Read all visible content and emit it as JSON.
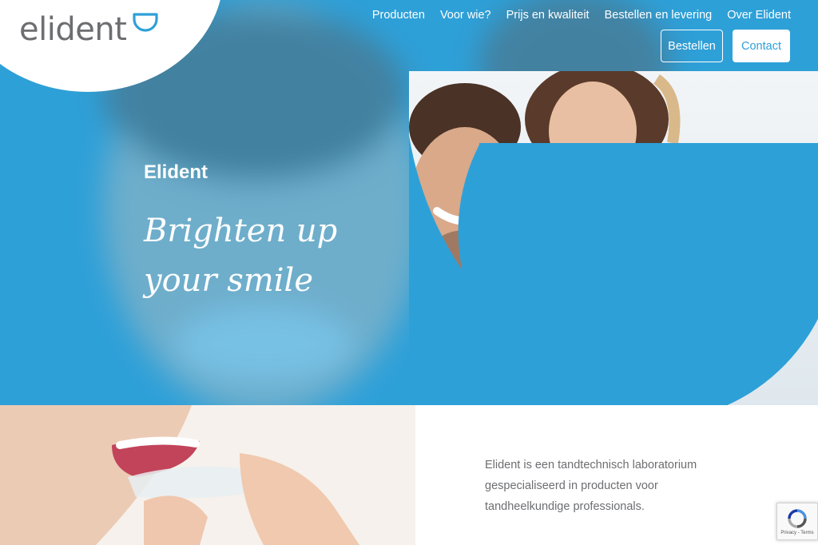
{
  "brand": {
    "logo_text": "elident",
    "logo_icon": "smile-icon"
  },
  "nav": {
    "items": [
      "Producten",
      "Voor wie?",
      "Prijs en kwaliteit",
      "Bestellen en levering",
      "Over Elident"
    ],
    "order_button": "Bestellen",
    "contact_button": "Contact"
  },
  "hero": {
    "label": "Elident",
    "tagline": "Brighten up your smile",
    "photo": "couple-smiling-photo"
  },
  "about": {
    "photo": "woman-inserting-aligner-photo",
    "text": "Elident is een tandtechnisch laboratorium gespecialiseerd in producten voor tandheelkundige professionals."
  },
  "recaptcha": {
    "label": "Privacy - Terms",
    "icon": "recaptcha-icon"
  },
  "colors": {
    "accent": "#2ea0d8",
    "text_gray": "#6d6e71",
    "white": "#ffffff"
  }
}
